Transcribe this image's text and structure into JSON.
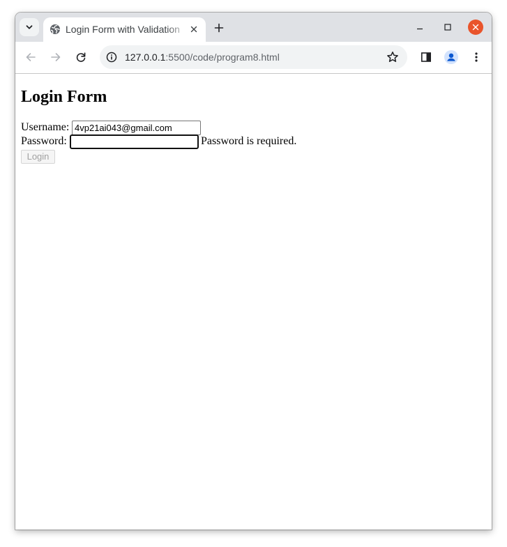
{
  "browser": {
    "tab": {
      "title": "Login Form with Validation"
    },
    "address_bar": {
      "url_host": "127.0.0.1",
      "url_rest": ":5500/code/program8.html"
    },
    "colors": {
      "tabstrip": "#dfe1e5",
      "close_button": "#e9542b",
      "profile_accent": "#1a73e8"
    }
  },
  "page": {
    "heading": "Login Form",
    "username": {
      "label": "Username:",
      "value": "4vp21ai043@gmail.com"
    },
    "password": {
      "label": "Password:",
      "value": "",
      "error": "Password is required."
    },
    "login_button": {
      "label": "Login",
      "disabled": true
    }
  }
}
